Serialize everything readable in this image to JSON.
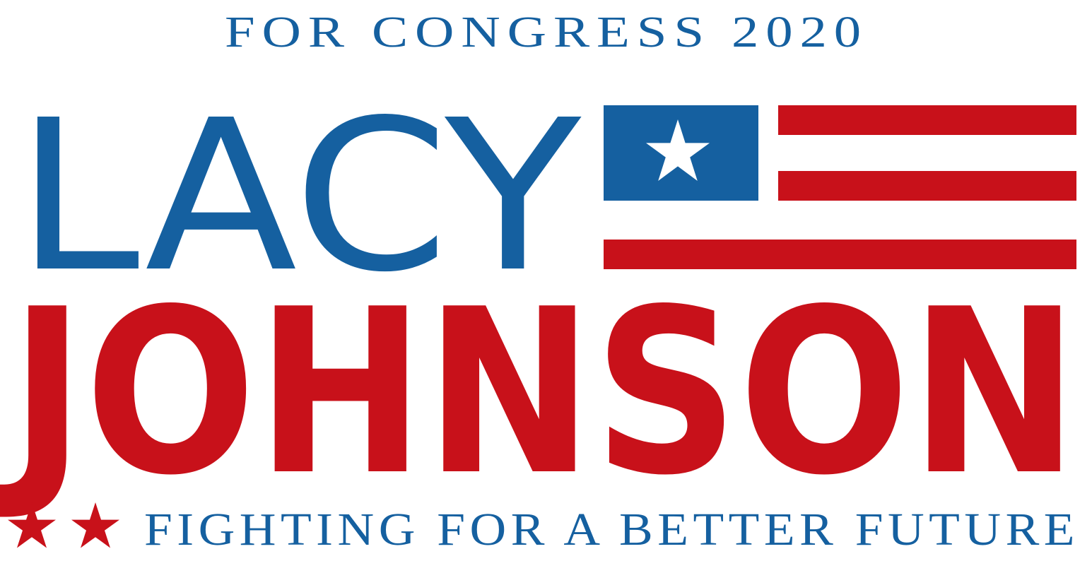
{
  "logo": {
    "tagline_top": "FOR CONGRESS 2020",
    "first_name": "LACY",
    "last_name": "JOHNSON",
    "slogan": "FIGHTING FOR A BETTER FUTURE",
    "stars_count": 2
  },
  "colors": {
    "blue": "#1560a0",
    "red": "#c8111a",
    "white": "#ffffff"
  }
}
